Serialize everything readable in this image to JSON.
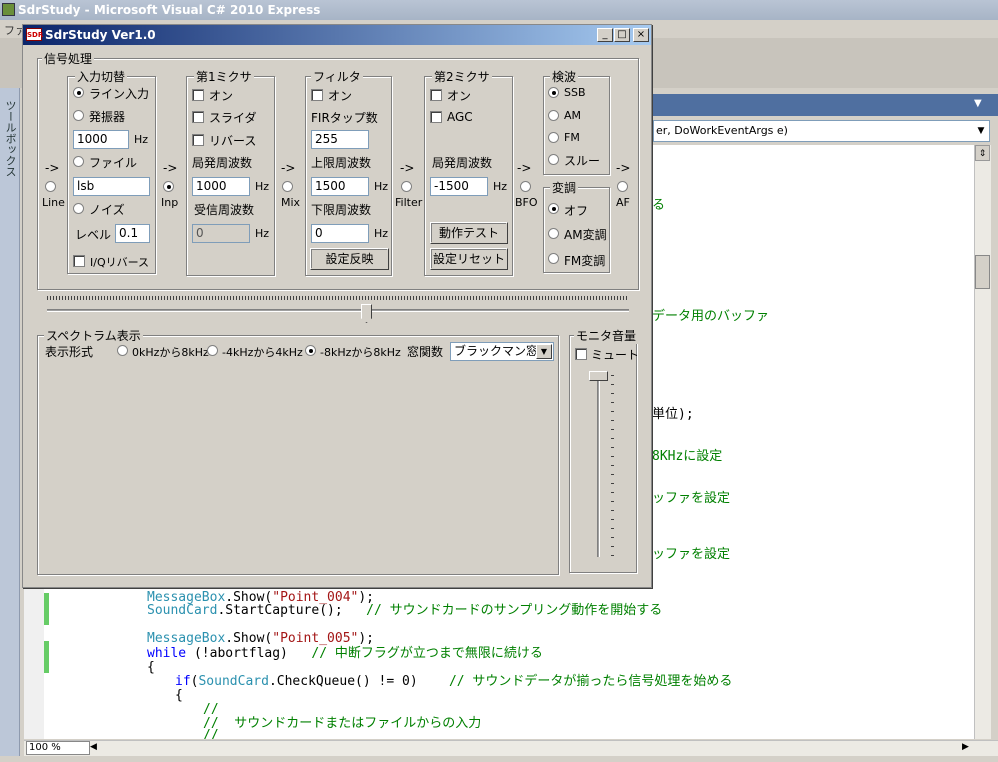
{
  "vs": {
    "title": "SdrStudy - Microsoft Visual C# 2010 Express",
    "menu_file": "ファ",
    "toolbox_label": "ツールボックス",
    "method_combo": "er, DoWorkEventArgs e)",
    "zoom": "100 %",
    "code_fragments": {
      "frag1": "る",
      "frag2": "データ用のバッファ",
      "frag3": "単位);",
      "frag4": "8KHzに設定",
      "frag5": "ッファを設定",
      "frag6": "ッファを設定"
    },
    "code_lines": {
      "l1_cls": "MessageBox",
      "l1_rest": ".Show(",
      "l1_str": "\"Point_004\"",
      "l1_end": ");",
      "l2_cls": "SoundCard",
      "l2_rest": ".StartCapture();   ",
      "l2_cmt": "// サウンドカードのサンプリング動作を開始する",
      "l3_cls": "MessageBox",
      "l3_rest": ".Show(",
      "l3_str": "\"Point_005\"",
      "l3_end": ");",
      "l4_kw": "while",
      "l4_rest": " (!abortflag)   ",
      "l4_cmt": "// 中断フラグが立つまで無限に続ける",
      "l5": "{",
      "l6_kw": "if",
      "l6_a": "(",
      "l6_cls": "SoundCard",
      "l6_rest": ".CheckQueue() != 0)    ",
      "l6_cmt": "// サウンドデータが揃ったら信号処理を始める",
      "l7": "{",
      "l8_cmt": "//",
      "l9_cmt": "//  サウンドカードまたはファイルからの入力",
      "l10_cmt": "//"
    }
  },
  "dialog": {
    "title": "SdrStudy Ver1.0",
    "icon_text": "SDR",
    "min": "_",
    "max": "□",
    "close": "×",
    "signal_group": "信号処理",
    "arrows": [
      "->",
      "->",
      "->",
      "->",
      "->",
      "->"
    ],
    "nodes": [
      "Line",
      "Inp",
      "Mix",
      "Filter",
      "BFO",
      "AF"
    ],
    "input": {
      "legend": "入力切替",
      "line_in": "ライン入力",
      "oscillator": "発振器",
      "freq": "1000",
      "unit": "Hz",
      "file": "ファイル",
      "file_name": "lsb",
      "noise": "ノイズ",
      "level_label": "レベル",
      "level": "0.1",
      "iq_reverse": "I/Qリバース"
    },
    "mixer1": {
      "legend": "第1ミクサ",
      "on": "オン",
      "slider": "スライダ",
      "reverse": "リバース",
      "local_label": "局発周波数",
      "local": "1000",
      "unit": "Hz",
      "rx_label": "受信周波数",
      "rx": "0",
      "rx_unit": "Hz"
    },
    "filter": {
      "legend": "フィルタ",
      "on": "オン",
      "taps_label": "FIRタップ数",
      "taps": "255",
      "upper_label": "上限周波数",
      "upper": "1500",
      "unit": "Hz",
      "lower_label": "下限周波数",
      "lower": "0",
      "lower_unit": "Hz",
      "apply": "設定反映"
    },
    "mixer2": {
      "legend": "第2ミクサ",
      "on": "オン",
      "agc": "AGC",
      "local_label": "局発周波数",
      "local": "-1500",
      "unit": "Hz",
      "test": "動作テスト",
      "reset": "設定リセット"
    },
    "detect": {
      "legend": "検波",
      "options": [
        "SSB",
        "AM",
        "FM",
        "スルー"
      ]
    },
    "modulate": {
      "legend": "変調",
      "options": [
        "オフ",
        "AM変調",
        "FM変調"
      ]
    },
    "slider_value": 0.55,
    "spectrum": {
      "legend": "スペクトラム表示",
      "format_label": "表示形式",
      "options": [
        "0kHzから8kHz",
        "-4kHzから4kHz",
        "-8kHzから8kHz"
      ],
      "window_label": "窓関数",
      "window": "ブラックマン窓"
    },
    "monitor": {
      "legend": "モニタ音量",
      "mute": "ミュート",
      "volume": 1.0
    }
  }
}
